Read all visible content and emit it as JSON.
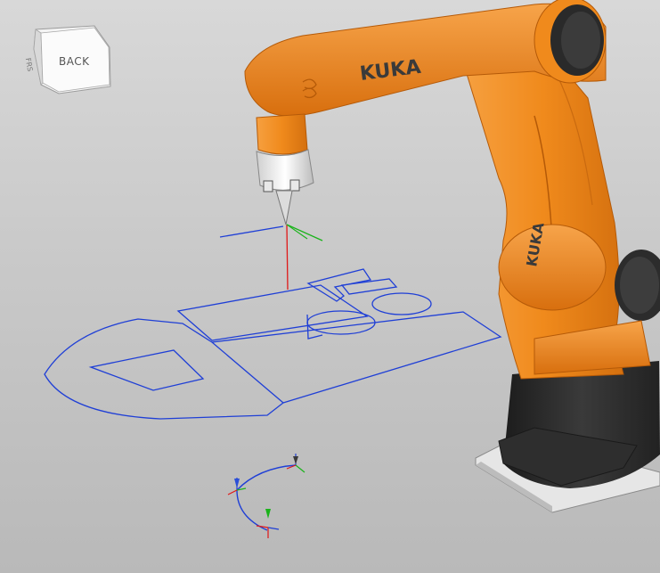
{
  "viewcube": {
    "face_label": "BACK",
    "edge_label": "FRS"
  },
  "robot": {
    "brand_arm": "KUKA",
    "brand_body": "KUKA"
  },
  "colors": {
    "robot_orange": "#f08a1c",
    "robot_orange_dark": "#c8650d",
    "robot_base": "#2a2a2a",
    "sketch_lines": "#1f3fd6",
    "axis_x": "#e01818",
    "axis_y": "#1ab31a",
    "axis_z": "#1f3fd6",
    "background": "#cccccc"
  },
  "icons": [
    "tool-frame-icon",
    "waypoint-marker-icon"
  ]
}
